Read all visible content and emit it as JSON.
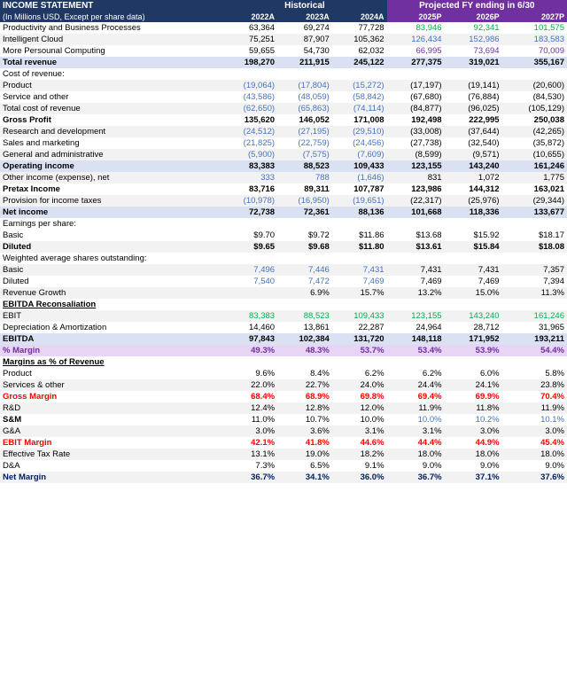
{
  "table": {
    "title": "INCOME STATEMENT",
    "subtitle": "(In Millions USD, Except per share data)",
    "sections": {
      "historical_label": "Historical",
      "projected_label": "Projected FY ending in 6/30",
      "years": [
        "2022A",
        "2023A",
        "2024A",
        "2025P",
        "2026P",
        "2027P"
      ]
    },
    "rows": [
      {
        "label": "Productivity and Business Processes",
        "vals": [
          "63,364",
          "69,274",
          "77,728",
          "83,946",
          "92,341",
          "101,575"
        ],
        "style": "normal",
        "val_styles": [
          "black",
          "black",
          "black",
          "green",
          "green",
          "green"
        ]
      },
      {
        "label": "Intelligent Cloud",
        "vals": [
          "75,251",
          "87,907",
          "105,362",
          "126,434",
          "152,986",
          "183,583"
        ],
        "style": "normal",
        "val_styles": [
          "black",
          "black",
          "black",
          "blue",
          "blue",
          "blue"
        ]
      },
      {
        "label": "More Persounal Computing",
        "vals": [
          "59,655",
          "54,730",
          "62,032",
          "66,995",
          "73,694",
          "70,009"
        ],
        "style": "normal",
        "val_styles": [
          "black",
          "black",
          "black",
          "purple",
          "purple",
          "purple"
        ]
      },
      {
        "label": "Total revenue",
        "vals": [
          "198,270",
          "211,915",
          "245,122",
          "277,375",
          "319,021",
          "355,167"
        ],
        "style": "total-rev bold",
        "val_styles": [
          "black",
          "black",
          "black",
          "black",
          "black",
          "black"
        ]
      },
      {
        "label": "Cost of revenue:",
        "vals": [
          "",
          "",
          "",
          "",
          "",
          ""
        ],
        "style": "normal",
        "val_styles": []
      },
      {
        "label": "  Product",
        "vals": [
          "(19,064)",
          "(17,804)",
          "(15,272)",
          "(17,197)",
          "(19,141)",
          "(20,600)"
        ],
        "style": "normal blue-vals",
        "val_styles": [
          "blue",
          "blue",
          "blue",
          "black",
          "black",
          "black"
        ]
      },
      {
        "label": "  Service and other",
        "vals": [
          "(43,586)",
          "(48,059)",
          "(58,842)",
          "(67,680)",
          "(76,884)",
          "(84,530)"
        ],
        "style": "normal blue-vals",
        "val_styles": [
          "blue",
          "blue",
          "blue",
          "black",
          "black",
          "black"
        ]
      },
      {
        "label": "Total cost of revenue",
        "vals": [
          "(62,650)",
          "(65,863)",
          "(74,114)",
          "(84,877)",
          "(96,025)",
          "(105,129)"
        ],
        "style": "normal blue-vals",
        "val_styles": [
          "blue",
          "blue",
          "blue",
          "black",
          "black",
          "black"
        ]
      },
      {
        "label": "Gross Profit",
        "vals": [
          "135,620",
          "146,052",
          "171,008",
          "192,498",
          "222,995",
          "250,038"
        ],
        "style": "gross-profit",
        "val_styles": [
          "black",
          "black",
          "black",
          "black",
          "black",
          "black"
        ]
      },
      {
        "label": "  Research and development",
        "vals": [
          "(24,512)",
          "(27,195)",
          "(29,510)",
          "(33,008)",
          "(37,644)",
          "(42,265)"
        ],
        "style": "blue-vals",
        "val_styles": [
          "blue",
          "blue",
          "blue",
          "black",
          "black",
          "black"
        ]
      },
      {
        "label": "  Sales and marketing",
        "vals": [
          "(21,825)",
          "(22,759)",
          "(24,456)",
          "(27,738)",
          "(32,540)",
          "(35,872)"
        ],
        "style": "blue-vals",
        "val_styles": [
          "blue",
          "blue",
          "blue",
          "black",
          "black",
          "black"
        ]
      },
      {
        "label": "  General and administrative",
        "vals": [
          "(5,900)",
          "(7,575)",
          "(7,609)",
          "(8,599)",
          "(9,571)",
          "(10,655)"
        ],
        "style": "blue-vals",
        "val_styles": [
          "blue",
          "blue",
          "blue",
          "black",
          "black",
          "black"
        ]
      },
      {
        "label": "Operating income",
        "vals": [
          "83,383",
          "88,523",
          "109,433",
          "123,155",
          "143,240",
          "161,246"
        ],
        "style": "op-income",
        "val_styles": [
          "black",
          "black",
          "black",
          "black",
          "black",
          "black"
        ]
      },
      {
        "label": "  Other income (expense), net",
        "vals": [
          "333",
          "788",
          "(1,646)",
          "831",
          "1,072",
          "1,775"
        ],
        "style": "blue-vals",
        "val_styles": [
          "blue",
          "blue",
          "blue",
          "black",
          "black",
          "black"
        ]
      },
      {
        "label": "Pretax Income",
        "vals": [
          "83,716",
          "89,311",
          "107,787",
          "123,986",
          "144,312",
          "163,021"
        ],
        "style": "pretax",
        "val_styles": [
          "black",
          "black",
          "black",
          "black",
          "black",
          "black"
        ]
      },
      {
        "label": "  Provision for income taxes",
        "vals": [
          "(10,978)",
          "(16,950)",
          "(19,651)",
          "(22,317)",
          "(25,976)",
          "(29,344)"
        ],
        "style": "blue-vals",
        "val_styles": [
          "blue",
          "blue",
          "blue",
          "black",
          "black",
          "black"
        ]
      },
      {
        "label": "Net income",
        "vals": [
          "72,738",
          "72,361",
          "88,136",
          "101,668",
          "118,336",
          "133,677"
        ],
        "style": "net-income",
        "val_styles": [
          "black",
          "black",
          "black",
          "black",
          "black",
          "black"
        ]
      },
      {
        "label": "Earnings per share:",
        "vals": [
          "",
          "",
          "",
          "",
          "",
          ""
        ],
        "style": "section-label",
        "val_styles": []
      },
      {
        "label": "  Basic",
        "vals": [
          "$9.70",
          "$9.72",
          "$11.86",
          "$13.68",
          "$15.92",
          "$18.17"
        ],
        "style": "normal",
        "val_styles": [
          "black",
          "black",
          "black",
          "black",
          "black",
          "black"
        ]
      },
      {
        "label": "  Diluted",
        "vals": [
          "$9.65",
          "$9.68",
          "$11.80",
          "$13.61",
          "$15.84",
          "$18.08"
        ],
        "style": "bold",
        "val_styles": [
          "black",
          "black",
          "black",
          "black",
          "black",
          "black"
        ]
      },
      {
        "label": "Weighted average shares outstanding:",
        "vals": [
          "",
          "",
          "",
          "",
          "",
          ""
        ],
        "style": "section-label",
        "val_styles": []
      },
      {
        "label": "  Basic",
        "vals": [
          "7,496",
          "7,446",
          "7,431",
          "7,431",
          "7,431",
          "7,357"
        ],
        "style": "blue-vals",
        "val_styles": [
          "blue",
          "blue",
          "blue",
          "black",
          "black",
          "black"
        ]
      },
      {
        "label": "  Diluted",
        "vals": [
          "7,540",
          "7,472",
          "7,469",
          "7,469",
          "7,469",
          "7,394"
        ],
        "style": "blue-vals",
        "val_styles": [
          "blue",
          "blue",
          "blue",
          "black",
          "black",
          "black"
        ]
      },
      {
        "label": "Revenue Growth",
        "vals": [
          "",
          "6.9%",
          "15.7%",
          "13.2%",
          "15.0%",
          "11.3%"
        ],
        "style": "normal",
        "val_styles": [
          "black",
          "black",
          "black",
          "black",
          "black",
          "black"
        ]
      },
      {
        "label": "EBITDA Reconsaliation",
        "vals": [
          "",
          "",
          "",
          "",
          "",
          ""
        ],
        "style": "section-header",
        "val_styles": []
      },
      {
        "label": "EBIT",
        "vals": [
          "83,383",
          "88,523",
          "109,433",
          "123,155",
          "143,240",
          "161,246"
        ],
        "style": "green-vals",
        "val_styles": [
          "green",
          "green",
          "green",
          "green",
          "green",
          "green"
        ]
      },
      {
        "label": "Depreciation & Amortization",
        "vals": [
          "14,460",
          "13,861",
          "22,287",
          "24,964",
          "28,712",
          "31,965"
        ],
        "style": "normal",
        "val_styles": [
          "black",
          "black",
          "black",
          "black",
          "black",
          "black"
        ]
      },
      {
        "label": "EBITDA",
        "vals": [
          "97,843",
          "102,384",
          "131,720",
          "148,118",
          "171,952",
          "193,211"
        ],
        "style": "ebitda-row",
        "val_styles": [
          "black",
          "black",
          "black",
          "black",
          "black",
          "black"
        ]
      },
      {
        "label": "% Margin",
        "vals": [
          "49.3%",
          "48.3%",
          "53.7%",
          "53.4%",
          "53.9%",
          "54.4%"
        ],
        "style": "margin-pct",
        "val_styles": [
          "purple",
          "purple",
          "purple",
          "purple",
          "purple",
          "purple"
        ]
      },
      {
        "label": "Margins as % of Revenue",
        "vals": [
          "",
          "",
          "",
          "",
          "",
          ""
        ],
        "style": "section-header",
        "val_styles": []
      },
      {
        "label": "Product",
        "vals": [
          "9.6%",
          "8.4%",
          "6.2%",
          "6.2%",
          "6.0%",
          "5.8%"
        ],
        "style": "normal",
        "val_styles": [
          "black",
          "black",
          "black",
          "black",
          "black",
          "black"
        ]
      },
      {
        "label": "Services & other",
        "vals": [
          "22.0%",
          "22.7%",
          "24.0%",
          "24.4%",
          "24.1%",
          "23.8%"
        ],
        "style": "normal",
        "val_styles": [
          "black",
          "black",
          "black",
          "black",
          "black",
          "black"
        ]
      },
      {
        "label": "Gross Margin",
        "vals": [
          "68.4%",
          "68.9%",
          "69.8%",
          "69.4%",
          "69.9%",
          "70.4%"
        ],
        "style": "gross-margin-row",
        "val_styles": [
          "red",
          "red",
          "red",
          "red",
          "red",
          "red"
        ]
      },
      {
        "label": "R&D",
        "vals": [
          "12.4%",
          "12.8%",
          "12.0%",
          "11.9%",
          "11.8%",
          "11.9%"
        ],
        "style": "normal",
        "val_styles": [
          "black",
          "black",
          "black",
          "black",
          "black",
          "black"
        ]
      },
      {
        "label": "S&M",
        "vals": [
          "11.0%",
          "10.7%",
          "10.0%",
          "10.0%",
          "10.2%",
          "10.1%"
        ],
        "style": "blue-bold-vals",
        "val_styles": [
          "black",
          "black",
          "black",
          "blue",
          "blue",
          "blue"
        ]
      },
      {
        "label": "G&A",
        "vals": [
          "3.0%",
          "3.6%",
          "3.1%",
          "3.1%",
          "3.0%",
          "3.0%"
        ],
        "style": "normal",
        "val_styles": [
          "black",
          "black",
          "black",
          "black",
          "black",
          "black"
        ]
      },
      {
        "label": "EBIT Margin",
        "vals": [
          "42.1%",
          "41.8%",
          "44.6%",
          "44.4%",
          "44.9%",
          "45.4%"
        ],
        "style": "ebit-margin",
        "val_styles": [
          "red",
          "red",
          "red",
          "red",
          "red",
          "red"
        ]
      },
      {
        "label": "Effective Tax Rate",
        "vals": [
          "13.1%",
          "19.0%",
          "18.2%",
          "18.0%",
          "18.0%",
          "18.0%"
        ],
        "style": "normal",
        "val_styles": [
          "black",
          "black",
          "black",
          "black",
          "black",
          "black"
        ]
      },
      {
        "label": "D&A",
        "vals": [
          "7.3%",
          "6.5%",
          "9.1%",
          "9.0%",
          "9.0%",
          "9.0%"
        ],
        "style": "normal",
        "val_styles": [
          "black",
          "black",
          "black",
          "black",
          "black",
          "black"
        ]
      },
      {
        "label": "Net Margin",
        "vals": [
          "36.7%",
          "34.1%",
          "36.0%",
          "36.7%",
          "37.1%",
          "37.6%"
        ],
        "style": "net-margin-row",
        "val_styles": [
          "darkblue",
          "darkblue",
          "darkblue",
          "darkblue",
          "darkblue",
          "darkblue"
        ]
      }
    ]
  }
}
